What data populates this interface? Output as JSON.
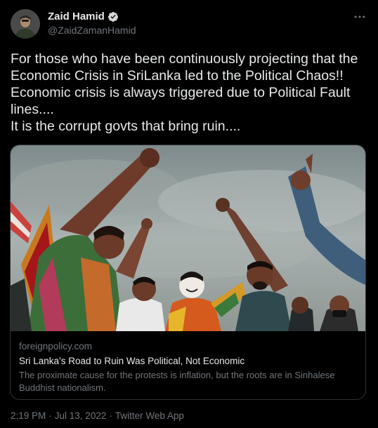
{
  "author": {
    "name": "Zaid Hamid",
    "handle": "@ZaidZamanHamid",
    "verified": true
  },
  "more_icon": "more-options-icon",
  "tweet": {
    "text": "For those who have been continuously projecting that the Economic Crisis in SriLanka led to the Political Chaos!! Economic crisis is always triggered due to Political Fault lines....\nIt is the corrupt govts that bring ruin...."
  },
  "card": {
    "domain": "foreignpolicy.com",
    "title": "Sri Lanka’s Road to Ruin Was Political, Not Economic",
    "description": "The proximate cause for the protests is inflation, but the roots are in Sinhalese Buddhist nationalism."
  },
  "footer": {
    "time": "2:19 PM",
    "sep1": "·",
    "date": "Jul 13, 2022",
    "sep2": "·",
    "source": "Twitter Web App"
  },
  "colors": {
    "background": "#000000",
    "text": "#e7e9ea",
    "secondary": "#71767b",
    "verified": "#d9d9d9",
    "border": "#2f3336"
  }
}
